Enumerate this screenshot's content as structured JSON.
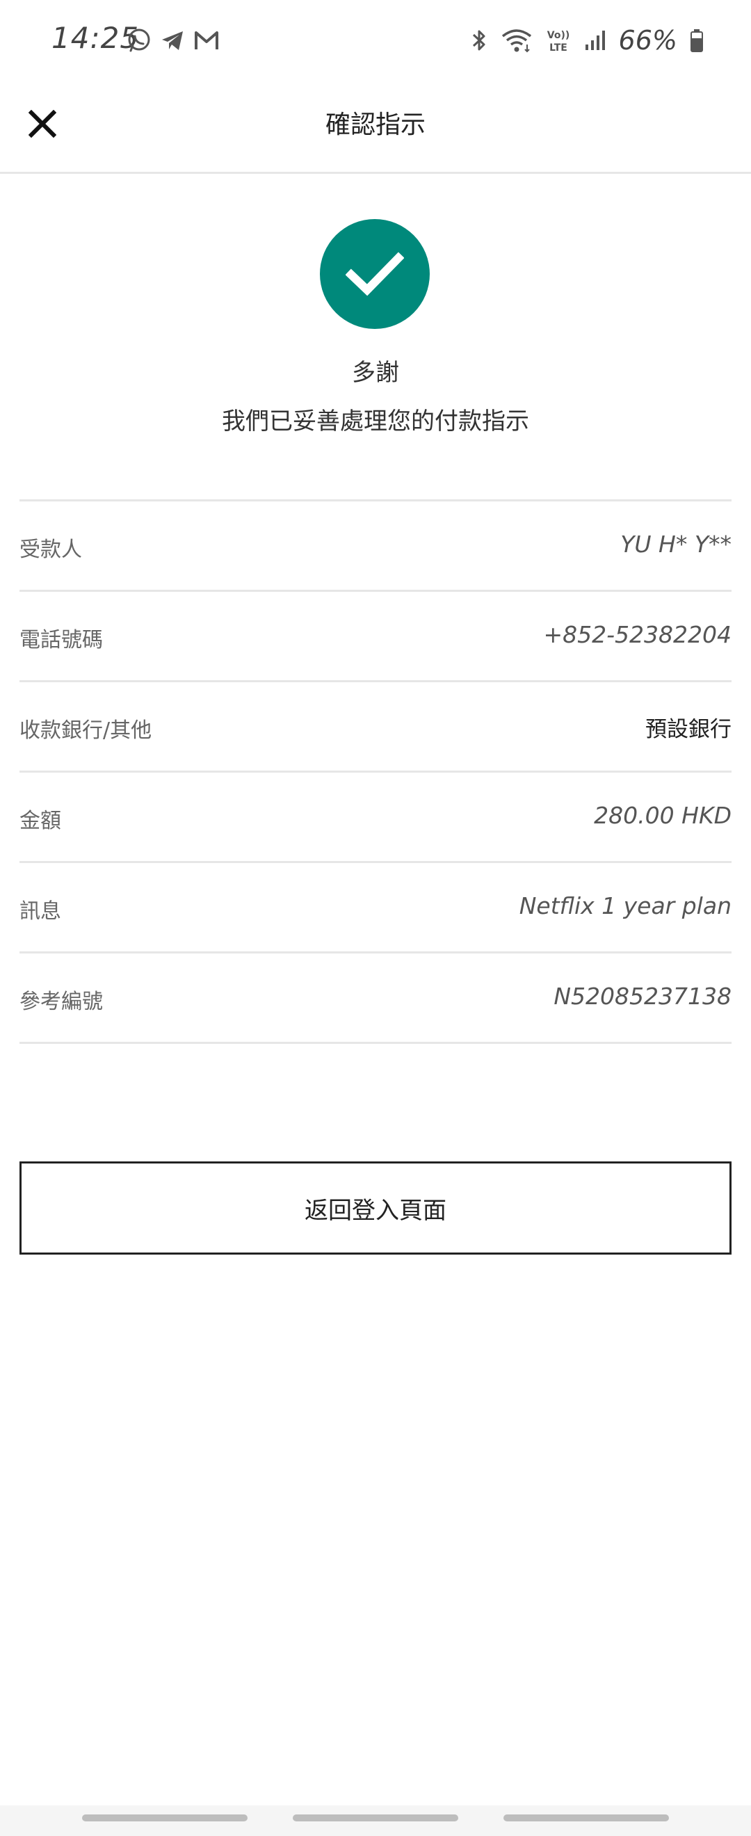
{
  "status_bar": {
    "time": "14:25",
    "battery": "66%",
    "left_icons": [
      "whatsapp-icon",
      "telegram-icon",
      "gmail-icon"
    ],
    "right_icons": [
      "bluetooth-icon",
      "wifi-icon",
      "volte-icon",
      "signal-icon",
      "battery-icon"
    ],
    "volte_label_top": "Vo))",
    "volte_label_bottom": "LTE"
  },
  "header": {
    "close_icon": "close-icon",
    "title": "確認指示"
  },
  "success": {
    "icon": "check-icon",
    "accent_color": "#00897b",
    "thanks": "多謝",
    "message": "我們已妥善處理您的付款指示"
  },
  "details": [
    {
      "label": "受款人",
      "value": "YU H* Y**"
    },
    {
      "label": "電話號碼",
      "value": "+852-52382204"
    },
    {
      "label": "收款銀行/其他",
      "value": "預設銀行"
    },
    {
      "label": "金額",
      "value": "280.00 HKD"
    },
    {
      "label": "訊息",
      "value": "Netflix 1 year plan"
    },
    {
      "label": "參考編號",
      "value": "N52085237138"
    }
  ],
  "return_button": {
    "label": "返回登入頁面"
  }
}
